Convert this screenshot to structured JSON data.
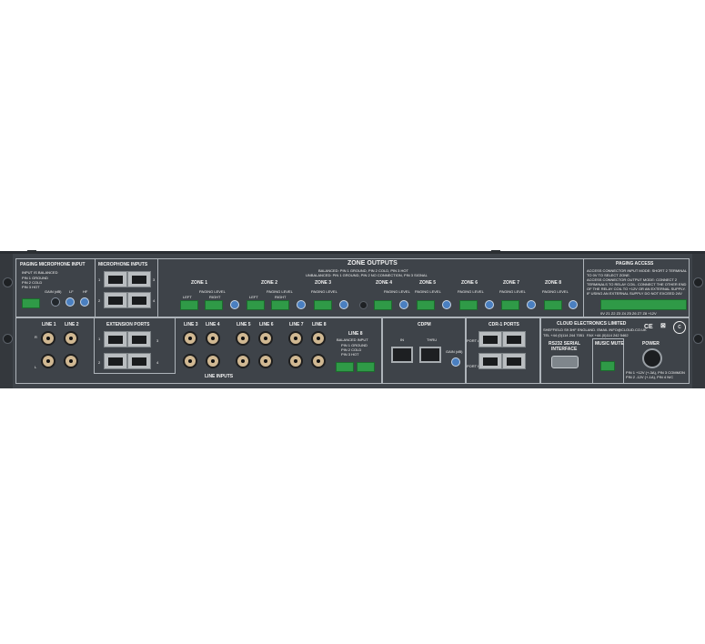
{
  "device": "Cloud Electronics rear panel",
  "sections": {
    "paging_mic": {
      "title": "PAGING MICROPHONE INPUT",
      "line1": "INPUT IS BALANCED",
      "line2": "PIN 1 GROUND",
      "line3": "PIN 2 COLD",
      "line4": "PIN 3 HOT",
      "gain": "GAIN (dB)",
      "lf": "LF",
      "hf": "HF"
    },
    "mic_inputs": {
      "title": "MICROPHONE INPUTS",
      "n1": "1",
      "n2": "2",
      "n3": "3",
      "n4": "4"
    },
    "zone_outputs": {
      "title": "ZONE OUTPUTS",
      "balanced": "BALANCED: PIN 1 GROUND, PIN 2 COLD, PIN 3 HOT",
      "unbalanced": "UNBALANCED: PIN 1 GROUND, PIN 2 NO CONNECTION, PIN 3 SIGNAL",
      "paging_level": "PAGING LEVEL",
      "left": "LEFT",
      "right": "RIGHT",
      "zones": [
        "ZONE 1",
        "ZONE 2",
        "ZONE 3",
        "ZONE 4",
        "ZONE 5",
        "ZONE 6",
        "ZONE 7",
        "ZONE 8"
      ]
    },
    "paging_access": {
      "title": "PAGING ACCESS",
      "l1": "ACCESS CONNECTOR INPUT MODE: SHORT 2 TERMINAL",
      "l2": "TO 0V TO SELECT ZONE.",
      "l3": "ACCESS CONNECTOR OUTPUT MODE: CONNECT 2",
      "l4": "TERMINALS TO RELAY COIL. CONNECT THE OTHER END",
      "l5": "OF THE RELAY COIL TO +12V OR AN EXTERNAL SUPPLY.",
      "l6": "IF USING AN EXTERNAL SUPPLY DO NOT EXCEED 24V",
      "pins": "0V  Z1  Z2  Z3  Z4  Z5  Z6  Z7  Z8  +12V"
    },
    "line_inputs": {
      "title": "LINE INPUTS",
      "lines": [
        "LINE 1",
        "LINE 2",
        "LINE 3",
        "LINE 4",
        "LINE 5",
        "LINE 6",
        "LINE 7",
        "LINE 8"
      ],
      "r": "R",
      "l": "L"
    },
    "extension": {
      "title": "EXTENSION PORTS",
      "n1": "1",
      "n2": "2",
      "n3": "3",
      "n4": "4"
    },
    "line8": {
      "title": "LINE 8",
      "sub": "BALANCED INPUT",
      "p1": "PIN 1 GROUND",
      "p2": "PIN 2 COLD",
      "p3": "PIN 3 HOT"
    },
    "cdpm": {
      "title": "CDPM",
      "in": "IN",
      "thru": "THRU",
      "gain": "GAIN (dB)"
    },
    "cdr": {
      "title": "CDR-1 PORTS",
      "port_a": "PORT A",
      "port_b": "PORT B"
    },
    "company": {
      "name": "CLOUD ELECTRONICS LIMITED",
      "addr": "SHEFFIELD S9 3HF ENGLAND. EMAIL INFO@CLOUD.CO.UK",
      "tel": "TEL +44 (0)114 244 7051",
      "fax": "FAX +44 (0)114 242 5462"
    },
    "rs232": {
      "title1": "RS232 SERIAL",
      "title2": "INTERFACE"
    },
    "music_mute": {
      "title": "MUSIC MUTE"
    },
    "power": {
      "title": "POWER",
      "l1": "PIN 1 +12V (+-3A), PIN 3 COMMON",
      "l2": "PIN 2 -12V (+-1A), PIN 4 N/C"
    },
    "marks": {
      "ce": "CE"
    }
  }
}
